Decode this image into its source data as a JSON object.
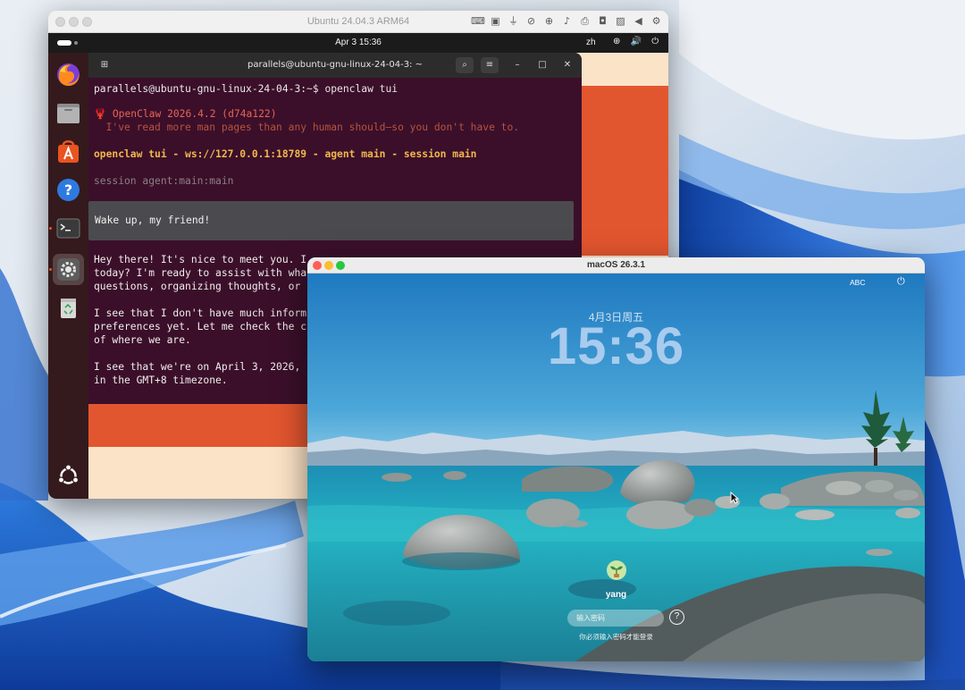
{
  "ubuntu_window": {
    "title": "Ubuntu 24.04.3 ARM64",
    "topbar": {
      "clock": "Apr 3  15:36",
      "language": "zh",
      "status_icons": "⊕ 🔊 ⏻"
    },
    "dock": [
      {
        "name": "firefox-icon"
      },
      {
        "name": "files-icon"
      },
      {
        "name": "app-center-icon"
      },
      {
        "name": "help-icon"
      },
      {
        "name": "terminal-icon"
      },
      {
        "name": "settings-icon"
      },
      {
        "name": "trash-icon"
      },
      {
        "name": "ubuntu-logo-icon"
      }
    ]
  },
  "terminal": {
    "title": "parallels@ubuntu-gnu-linux-24-04-3: ~",
    "prompt_user": "parallels@ubuntu-gnu-linux-24-04-3",
    "prompt_suffix": ":~$ openclaw tui",
    "app_header": "🦞 OpenClaw 2026.4.2 (d74a122)",
    "tagline": "  I've read more man pages than any human should—so you don't have to.",
    "connection": "openclaw tui - ws://127.0.0.1:18789 - agent main - session main",
    "session": "session agent:main:main",
    "user_message": "Wake up, my friend!",
    "reply_lines": [
      "Hey there! It's nice to meet you. I",
      "today? I'm ready to assist with wha",
      "questions, organizing thoughts, or ",
      "",
      "I see that I don't have much inform",
      "preferences yet. Let me check the c",
      "of where we are.",
      "",
      "I see that we're on April 3, 2026, ",
      "in the GMT+8 timezone."
    ]
  },
  "mac_window": {
    "title": "macOS 26.3.1",
    "menu_input": "ABC",
    "lock_date": "4月3日周五",
    "lock_time": "15:36",
    "username": "yang",
    "password_placeholder": "输入密码",
    "hint": "你必须输入密码才能登录",
    "help_label": "?"
  },
  "colors": {
    "ubuntu_orange": "#e2562f",
    "terminal_bg": "#3b0f2a",
    "dock_bg": "#341a1d",
    "openclaw_accent": "#f0b84a"
  }
}
